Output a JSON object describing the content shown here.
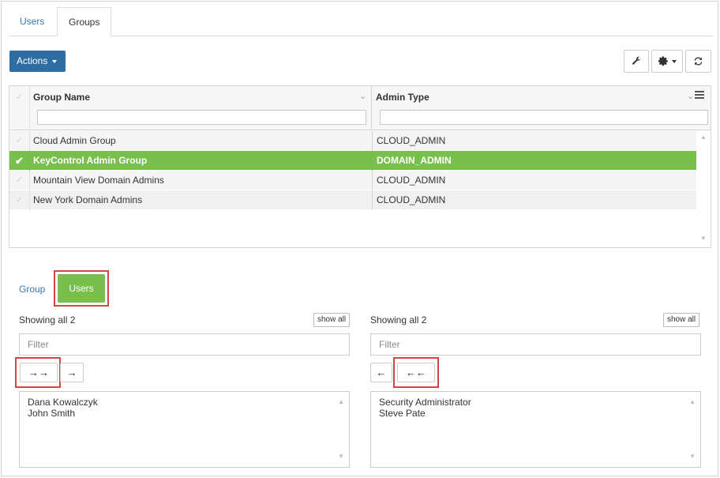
{
  "top_tabs": [
    {
      "label": "Users",
      "active": false
    },
    {
      "label": "Groups",
      "active": true
    }
  ],
  "toolbar": {
    "actions_label": "Actions",
    "icons": [
      "wrench-icon",
      "gear-icon",
      "refresh-icon"
    ]
  },
  "grid": {
    "columns": [
      {
        "label": "Group Name"
      },
      {
        "label": "Admin Type"
      }
    ],
    "rows": [
      {
        "name": "Cloud Admin Group",
        "type": "CLOUD_ADMIN",
        "selected": false
      },
      {
        "name": "KeyControl Admin Group",
        "type": "DOMAIN_ADMIN",
        "selected": true
      },
      {
        "name": "Mountain View Domain Admins",
        "type": "CLOUD_ADMIN",
        "selected": false
      },
      {
        "name": "New York Domain Admins",
        "type": "CLOUD_ADMIN",
        "selected": false
      }
    ]
  },
  "detail_tabs": {
    "group_label": "Group",
    "users_label": "Users"
  },
  "left_panel": {
    "showing": "Showing all 2",
    "show_all": "show all",
    "filter_placeholder": "Filter",
    "items": [
      "Dana Kowalczyk",
      "John Smith"
    ]
  },
  "right_panel": {
    "showing": "Showing all 2",
    "show_all": "show all",
    "filter_placeholder": "Filter",
    "items": [
      "Security Administrator",
      "Steve Pate"
    ]
  },
  "colors": {
    "accent": "#2e6da4",
    "selected": "#78c04b",
    "highlight": "#d9433f",
    "link": "#337ab7"
  }
}
